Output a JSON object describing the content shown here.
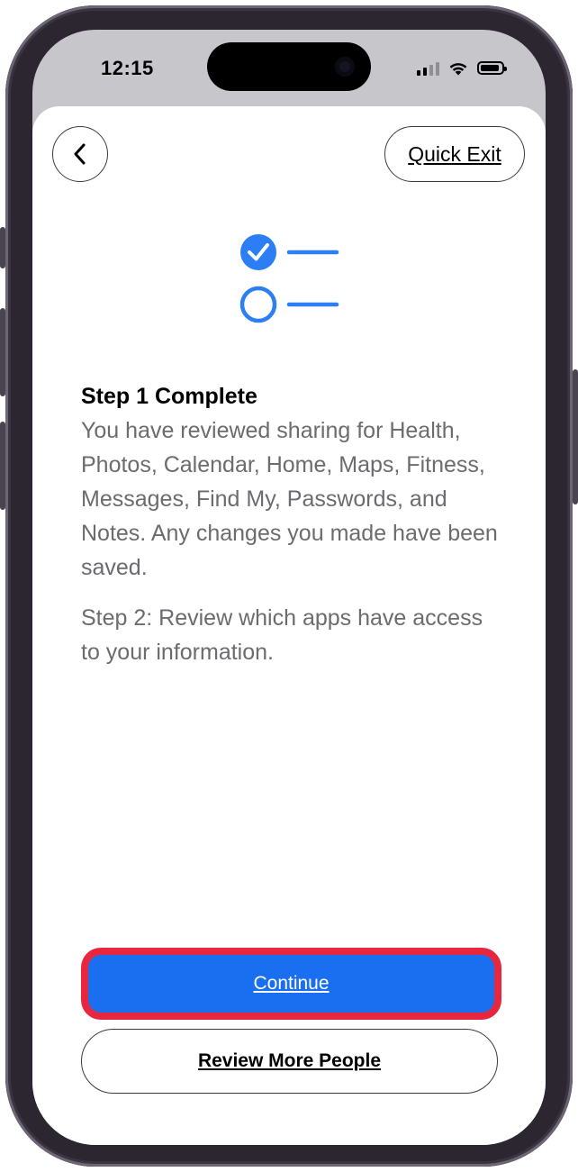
{
  "status_bar": {
    "time": "12:15"
  },
  "header": {
    "back_icon": "chevron-left-icon",
    "quick_exit_label": "Quick Exit"
  },
  "illustration": {
    "icon": "checklist-icon",
    "accent_color": "#2b7ef3"
  },
  "content": {
    "title": "Step 1 Complete",
    "body": "You have reviewed sharing for Health, Photos, Calendar, Home, Maps, Fitness, Messages, Find My, Passwords, and Notes. Any changes you made have been saved.",
    "step2": "Step 2: Review which apps have access to your information."
  },
  "actions": {
    "continue_label": "Continue",
    "review_more_label": "Review More People",
    "continue_color": "#1a6ff0",
    "highlight_color": "#e8273f"
  }
}
